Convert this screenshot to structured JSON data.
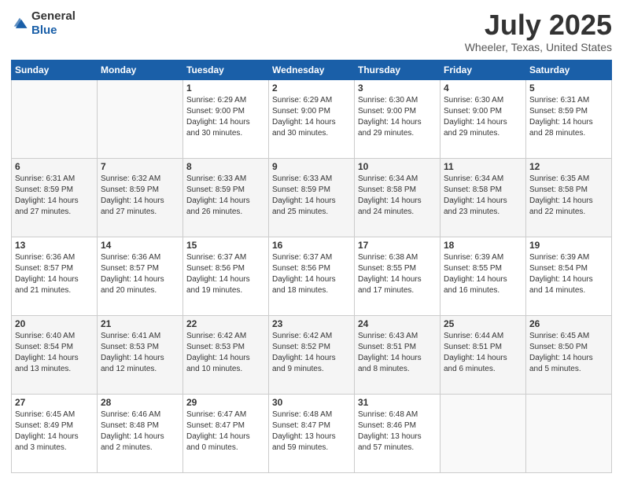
{
  "logo": {
    "general": "General",
    "blue": "Blue"
  },
  "header": {
    "month": "July 2025",
    "location": "Wheeler, Texas, United States"
  },
  "weekdays": [
    "Sunday",
    "Monday",
    "Tuesday",
    "Wednesday",
    "Thursday",
    "Friday",
    "Saturday"
  ],
  "weeks": [
    [
      {
        "day": "",
        "info": ""
      },
      {
        "day": "",
        "info": ""
      },
      {
        "day": "1",
        "info": "Sunrise: 6:29 AM\nSunset: 9:00 PM\nDaylight: 14 hours and 30 minutes."
      },
      {
        "day": "2",
        "info": "Sunrise: 6:29 AM\nSunset: 9:00 PM\nDaylight: 14 hours and 30 minutes."
      },
      {
        "day": "3",
        "info": "Sunrise: 6:30 AM\nSunset: 9:00 PM\nDaylight: 14 hours and 29 minutes."
      },
      {
        "day": "4",
        "info": "Sunrise: 6:30 AM\nSunset: 9:00 PM\nDaylight: 14 hours and 29 minutes."
      },
      {
        "day": "5",
        "info": "Sunrise: 6:31 AM\nSunset: 8:59 PM\nDaylight: 14 hours and 28 minutes."
      }
    ],
    [
      {
        "day": "6",
        "info": "Sunrise: 6:31 AM\nSunset: 8:59 PM\nDaylight: 14 hours and 27 minutes."
      },
      {
        "day": "7",
        "info": "Sunrise: 6:32 AM\nSunset: 8:59 PM\nDaylight: 14 hours and 27 minutes."
      },
      {
        "day": "8",
        "info": "Sunrise: 6:33 AM\nSunset: 8:59 PM\nDaylight: 14 hours and 26 minutes."
      },
      {
        "day": "9",
        "info": "Sunrise: 6:33 AM\nSunset: 8:59 PM\nDaylight: 14 hours and 25 minutes."
      },
      {
        "day": "10",
        "info": "Sunrise: 6:34 AM\nSunset: 8:58 PM\nDaylight: 14 hours and 24 minutes."
      },
      {
        "day": "11",
        "info": "Sunrise: 6:34 AM\nSunset: 8:58 PM\nDaylight: 14 hours and 23 minutes."
      },
      {
        "day": "12",
        "info": "Sunrise: 6:35 AM\nSunset: 8:58 PM\nDaylight: 14 hours and 22 minutes."
      }
    ],
    [
      {
        "day": "13",
        "info": "Sunrise: 6:36 AM\nSunset: 8:57 PM\nDaylight: 14 hours and 21 minutes."
      },
      {
        "day": "14",
        "info": "Sunrise: 6:36 AM\nSunset: 8:57 PM\nDaylight: 14 hours and 20 minutes."
      },
      {
        "day": "15",
        "info": "Sunrise: 6:37 AM\nSunset: 8:56 PM\nDaylight: 14 hours and 19 minutes."
      },
      {
        "day": "16",
        "info": "Sunrise: 6:37 AM\nSunset: 8:56 PM\nDaylight: 14 hours and 18 minutes."
      },
      {
        "day": "17",
        "info": "Sunrise: 6:38 AM\nSunset: 8:55 PM\nDaylight: 14 hours and 17 minutes."
      },
      {
        "day": "18",
        "info": "Sunrise: 6:39 AM\nSunset: 8:55 PM\nDaylight: 14 hours and 16 minutes."
      },
      {
        "day": "19",
        "info": "Sunrise: 6:39 AM\nSunset: 8:54 PM\nDaylight: 14 hours and 14 minutes."
      }
    ],
    [
      {
        "day": "20",
        "info": "Sunrise: 6:40 AM\nSunset: 8:54 PM\nDaylight: 14 hours and 13 minutes."
      },
      {
        "day": "21",
        "info": "Sunrise: 6:41 AM\nSunset: 8:53 PM\nDaylight: 14 hours and 12 minutes."
      },
      {
        "day": "22",
        "info": "Sunrise: 6:42 AM\nSunset: 8:53 PM\nDaylight: 14 hours and 10 minutes."
      },
      {
        "day": "23",
        "info": "Sunrise: 6:42 AM\nSunset: 8:52 PM\nDaylight: 14 hours and 9 minutes."
      },
      {
        "day": "24",
        "info": "Sunrise: 6:43 AM\nSunset: 8:51 PM\nDaylight: 14 hours and 8 minutes."
      },
      {
        "day": "25",
        "info": "Sunrise: 6:44 AM\nSunset: 8:51 PM\nDaylight: 14 hours and 6 minutes."
      },
      {
        "day": "26",
        "info": "Sunrise: 6:45 AM\nSunset: 8:50 PM\nDaylight: 14 hours and 5 minutes."
      }
    ],
    [
      {
        "day": "27",
        "info": "Sunrise: 6:45 AM\nSunset: 8:49 PM\nDaylight: 14 hours and 3 minutes."
      },
      {
        "day": "28",
        "info": "Sunrise: 6:46 AM\nSunset: 8:48 PM\nDaylight: 14 hours and 2 minutes."
      },
      {
        "day": "29",
        "info": "Sunrise: 6:47 AM\nSunset: 8:47 PM\nDaylight: 14 hours and 0 minutes."
      },
      {
        "day": "30",
        "info": "Sunrise: 6:48 AM\nSunset: 8:47 PM\nDaylight: 13 hours and 59 minutes."
      },
      {
        "day": "31",
        "info": "Sunrise: 6:48 AM\nSunset: 8:46 PM\nDaylight: 13 hours and 57 minutes."
      },
      {
        "day": "",
        "info": ""
      },
      {
        "day": "",
        "info": ""
      }
    ]
  ]
}
